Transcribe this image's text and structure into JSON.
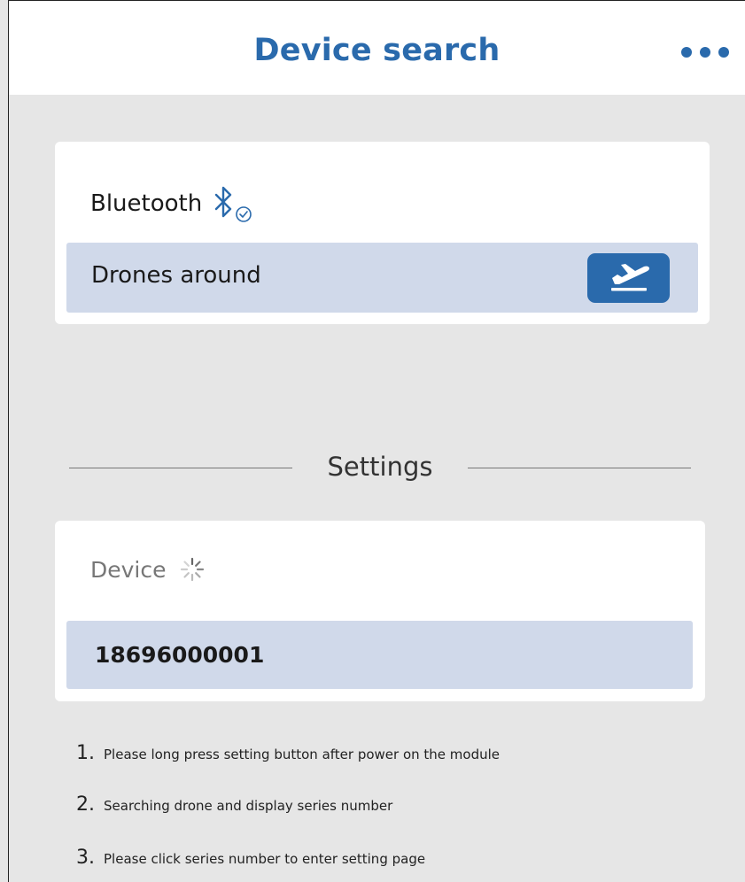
{
  "header": {
    "title": "Device search",
    "more_icon": "more-horizontal-icon",
    "accent_color": "#2a6aac"
  },
  "bluetooth_card": {
    "label": "Bluetooth",
    "status_icon": "bluetooth-connected-icon",
    "drones_row": {
      "label": "Drones around",
      "action_icon": "takeoff-icon"
    }
  },
  "settings_section": {
    "title": "Settings"
  },
  "device_card": {
    "label": "Device",
    "status_icon": "loading-spinner-icon",
    "serial_number": "18696000001"
  },
  "instructions": [
    {
      "number": "1.",
      "text": "Please long press setting button after power on the module"
    },
    {
      "number": "2.",
      "text": "Searching drone and display series number"
    },
    {
      "number": "3.",
      "text": "Please click series number to enter setting page"
    }
  ]
}
